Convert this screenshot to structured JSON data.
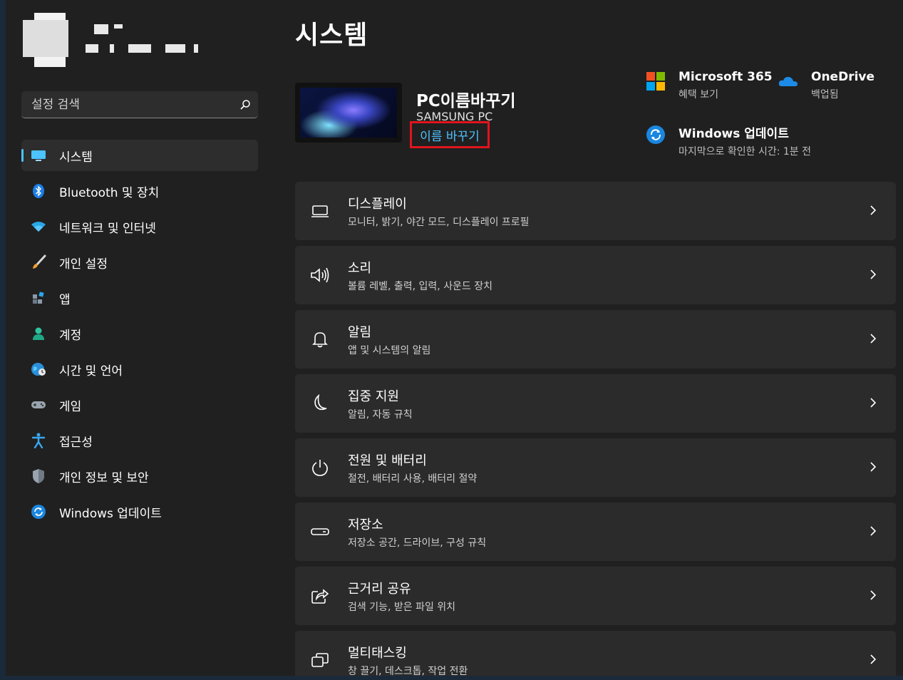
{
  "sidebar": {
    "search_placeholder": "설정 검색",
    "items": [
      {
        "label": "시스템",
        "icon": "monitor-icon",
        "active": true
      },
      {
        "label": "Bluetooth 및 장치",
        "icon": "bluetooth-icon"
      },
      {
        "label": "네트워크 및 인터넷",
        "icon": "wifi-icon"
      },
      {
        "label": "개인 설정",
        "icon": "brush-icon"
      },
      {
        "label": "앱",
        "icon": "apps-icon"
      },
      {
        "label": "계정",
        "icon": "person-icon"
      },
      {
        "label": "시간 및 언어",
        "icon": "globe-clock-icon"
      },
      {
        "label": "게임",
        "icon": "gamepad-icon"
      },
      {
        "label": "접근성",
        "icon": "accessibility-icon"
      },
      {
        "label": "개인 정보 및 보안",
        "icon": "shield-icon"
      },
      {
        "label": "Windows 업데이트",
        "icon": "update-icon"
      }
    ]
  },
  "main": {
    "title": "시스템",
    "pc": {
      "name": "PC이름바꾸기",
      "model": "SAMSUNG PC",
      "rename_link": "이름 바꾸기"
    },
    "quick": {
      "m365_title": "Microsoft 365",
      "m365_sub": "혜택 보기",
      "onedrive_title": "OneDrive",
      "onedrive_sub": "백업됨",
      "update_title": "Windows 업데이트",
      "update_sub": "마지막으로 확인한 시간: 1분 전"
    },
    "cards": [
      {
        "title": "디스플레이",
        "sub": "모니터, 밝기, 야간 모드, 디스플레이 프로필",
        "icon": "display-icon"
      },
      {
        "title": "소리",
        "sub": "볼륨 레벨, 출력, 입력, 사운드 장치",
        "icon": "speaker-icon"
      },
      {
        "title": "알림",
        "sub": "앱 및 시스템의 알림",
        "icon": "bell-icon"
      },
      {
        "title": "집중 지원",
        "sub": "알림, 자동 규칙",
        "icon": "moon-icon"
      },
      {
        "title": "전원 및 배터리",
        "sub": "절전, 배터리 사용, 배터리 절약",
        "icon": "power-icon"
      },
      {
        "title": "저장소",
        "sub": "저장소 공간, 드라이브, 구성 규칙",
        "icon": "storage-icon"
      },
      {
        "title": "근거리 공유",
        "sub": "검색 기능, 받은 파일 위치",
        "icon": "share-icon"
      },
      {
        "title": "멀티태스킹",
        "sub": "창 끌기, 데스크톱, 작업 전환",
        "icon": "multitask-icon"
      }
    ]
  },
  "colors": {
    "accent": "#4cc2ff",
    "highlight_box": "#e0141c",
    "background": "#202020",
    "card": "#2b2b2b"
  }
}
